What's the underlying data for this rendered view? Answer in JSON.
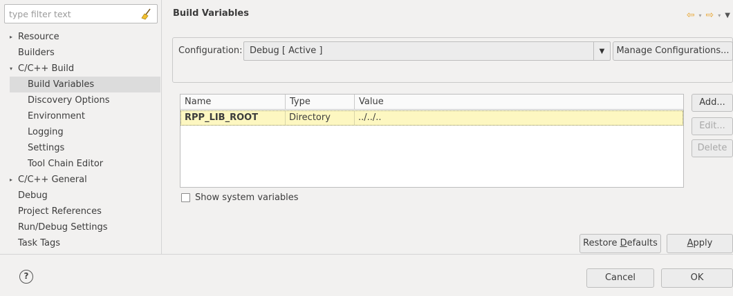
{
  "filter": {
    "placeholder": "type filter text",
    "clear_icon": "broom-icon"
  },
  "tree": [
    {
      "label": "Resource",
      "indent": 1,
      "arrow": "collapsed"
    },
    {
      "label": "Builders",
      "indent": 1
    },
    {
      "label": "C/C++ Build",
      "indent": 1,
      "arrow": "expanded"
    },
    {
      "label": "Build Variables",
      "indent": 2,
      "selected": true
    },
    {
      "label": "Discovery Options",
      "indent": 2
    },
    {
      "label": "Environment",
      "indent": 2
    },
    {
      "label": "Logging",
      "indent": 2
    },
    {
      "label": "Settings",
      "indent": 2
    },
    {
      "label": "Tool Chain Editor",
      "indent": 2
    },
    {
      "label": "C/C++ General",
      "indent": 1,
      "arrow": "collapsed"
    },
    {
      "label": "Debug",
      "indent": 1
    },
    {
      "label": "Project References",
      "indent": 1
    },
    {
      "label": "Run/Debug Settings",
      "indent": 1
    },
    {
      "label": "Task Tags",
      "indent": 1
    }
  ],
  "page": {
    "title": "Build Variables",
    "nav_icons": [
      "back-arrow-icon",
      "forward-arrow-icon",
      "view-menu-icon"
    ]
  },
  "config": {
    "label": "Configuration:",
    "selected": "Debug [ Active ]",
    "manage_label": "Manage Configurations..."
  },
  "table": {
    "columns": [
      "Name",
      "Type",
      "Value"
    ],
    "rows": [
      {
        "name": "RPP_LIB_ROOT",
        "type": "Directory",
        "value": "../../.."
      }
    ]
  },
  "side_buttons": {
    "add": "Add...",
    "edit": "Edit...",
    "delete": "Delete"
  },
  "show_system_variables": {
    "label": "Show system variables",
    "checked": false
  },
  "buttons": {
    "restore_defaults_pre": "Restore ",
    "restore_defaults_u": "D",
    "restore_defaults_post": "efaults",
    "apply_u": "A",
    "apply_post": "pply",
    "cancel": "Cancel",
    "ok": "OK"
  },
  "colors": {
    "selection": "#dcdcdc",
    "row_highlight": "#fdf7c1",
    "nav_arrow": "#e8a530"
  }
}
